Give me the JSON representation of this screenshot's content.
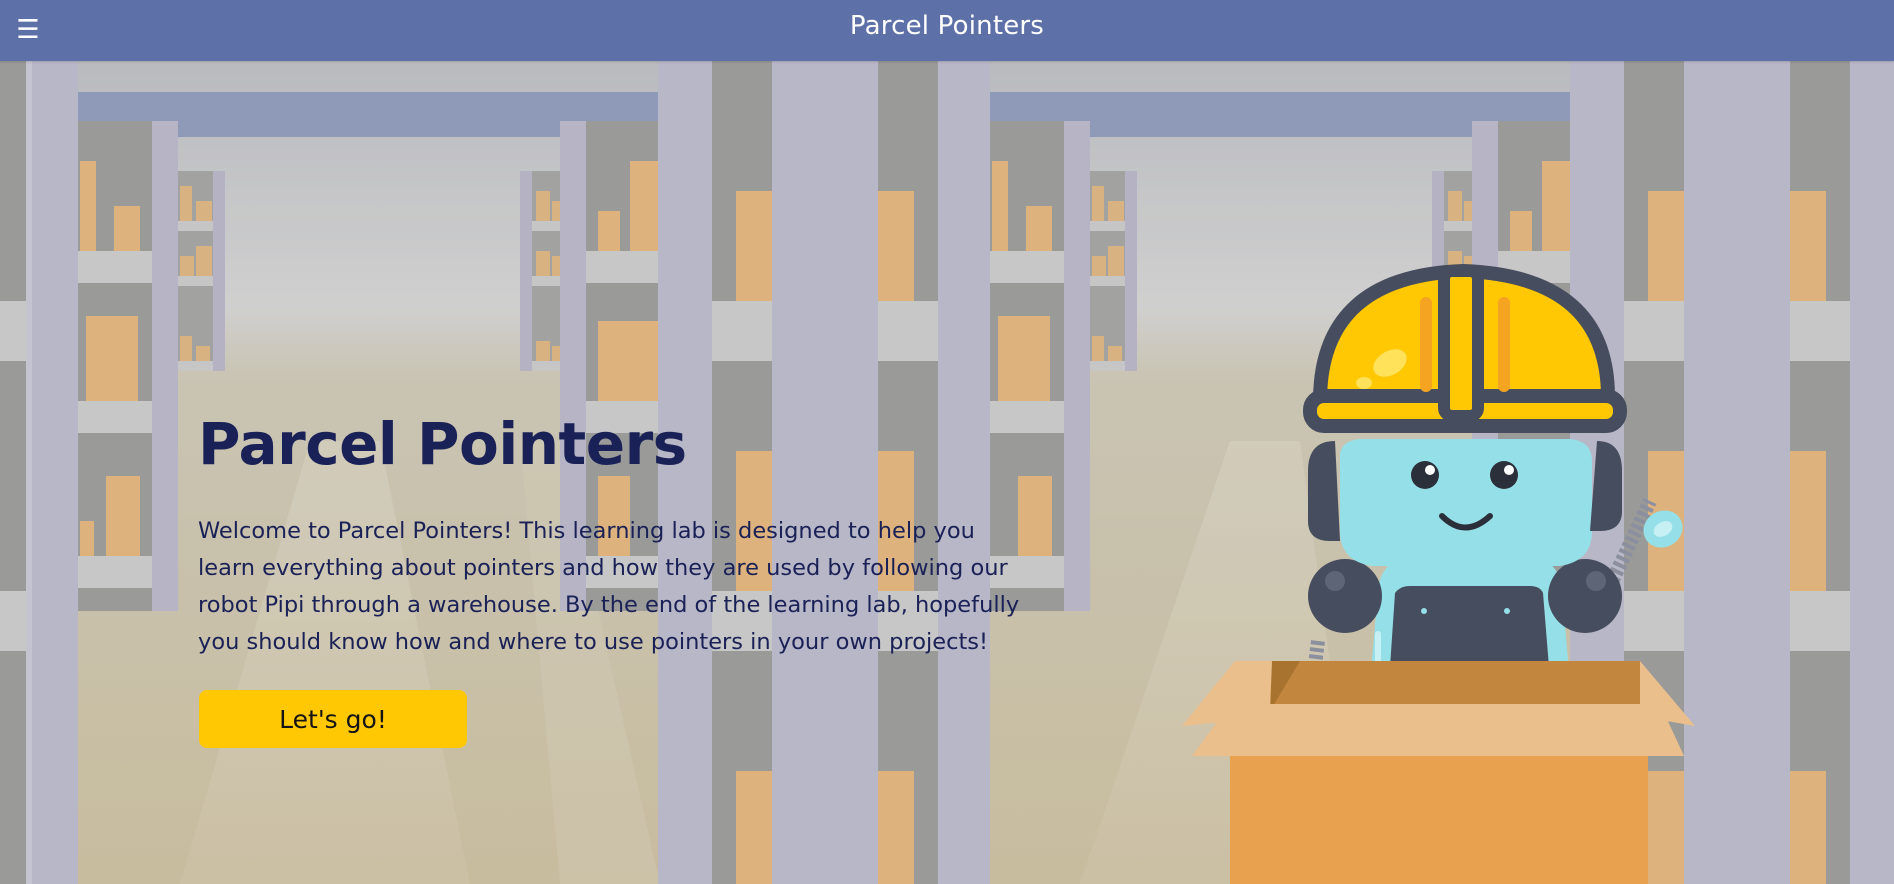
{
  "header": {
    "menu_icon": "hamburger-icon",
    "title": "Parcel Pointers"
  },
  "hero": {
    "title": "Parcel Pointers",
    "description": "Welcome to Parcel Pointers! This learning lab is designed to help you learn everything about pointers and how they are used by following our robot Pipi through a warehouse. By the end of the learning lab, hopefully you should know how and where to use pointers in your own projects!",
    "cta_label": "Let's go!"
  },
  "colors": {
    "header_bg": "#5d70a8",
    "heading_text": "#1a2157",
    "cta_bg": "#ffc803",
    "robot_body": "#95e0e8",
    "helmet": "#ffc803",
    "box": "#e8a24f"
  }
}
